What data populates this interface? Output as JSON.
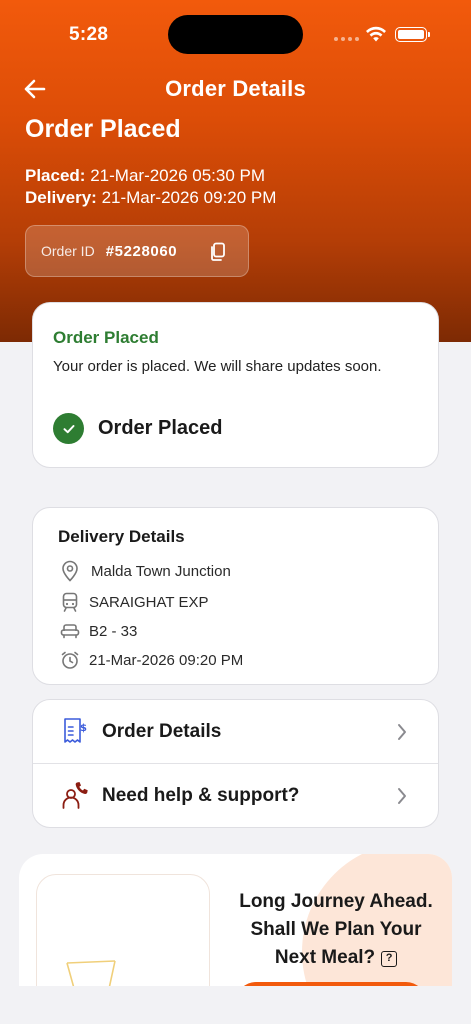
{
  "status_bar": {
    "time": "5:28"
  },
  "header": {
    "title": "Order Details",
    "order_status": "Order Placed"
  },
  "dates": {
    "placed_label": "Placed:",
    "placed_value": "21-Mar-2026 05:30 PM",
    "delivery_label": "Delivery:",
    "delivery_value": "21-Mar-2026 09:20 PM"
  },
  "order_id": {
    "label": "Order ID",
    "value": "#5228060"
  },
  "status_card": {
    "heading": "Order Placed",
    "message": "Your order is placed. We will share updates soon.",
    "step": "Order Placed"
  },
  "delivery": {
    "heading": "Delivery Details",
    "station": "Malda Town Junction",
    "train": "SARAIGHAT EXP",
    "seat": "B2 - 33",
    "time": "21-Mar-2026 09:20 PM"
  },
  "actions": {
    "order_details": "Order Details",
    "support": "Need help & support?"
  },
  "promo": {
    "line1": "Long Journey Ahead.",
    "line2": "Shall We Plan Your",
    "line3": "Next Meal?"
  },
  "colors": {
    "brand": "#f25a0c",
    "success": "#2e7d32",
    "support_icon": "#8b1d12",
    "order_icon": "#3b5bdb"
  }
}
